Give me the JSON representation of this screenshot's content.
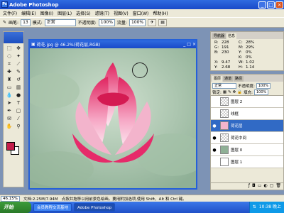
{
  "app": {
    "title": "Adobe Photoshop",
    "icon_label": "Ps"
  },
  "menus": [
    "文件(F)",
    "编辑(E)",
    "图像(I)",
    "图层(L)",
    "选择(S)",
    "滤镜(T)",
    "视图(V)",
    "窗口(W)",
    "帮助(H)"
  ],
  "options": {
    "brush_label": "画笔:",
    "brush_size": "13",
    "mode_label": "模式:",
    "mode_value": "正常",
    "opacity_label": "不透明度:",
    "opacity_value": "100%",
    "flow_label": "流量:",
    "flow_value": "100%"
  },
  "document": {
    "title": "荷花.jpg @ 46.2%(荷花层,RGB)"
  },
  "navigator": {
    "tabs": [
      "导航器",
      "信息"
    ],
    "info": [
      {
        "l1": "R:",
        "v1": "228",
        "l2": "C:",
        "v2": "28%"
      },
      {
        "l1": "G:",
        "v1": "191",
        "l2": "M:",
        "v2": "29%"
      },
      {
        "l1": "B:",
        "v1": "230",
        "l2": "Y:",
        "v2": "0%"
      },
      {
        "l1": "",
        "v1": "",
        "l2": "K:",
        "v2": "0%"
      },
      {
        "l1": "X:",
        "v1": "9.47",
        "l2": "W:",
        "v2": "1.02"
      },
      {
        "l1": "Y:",
        "v1": "2.68",
        "l2": "H:",
        "v2": "1.14"
      }
    ]
  },
  "layers": {
    "tabs": [
      "图层",
      "通道",
      "路径"
    ],
    "blend_mode": "正常",
    "opacity_label": "不透明度:",
    "opacity_value": "100%",
    "lock_label": "锁定:",
    "fill_label": "填充:",
    "fill_value": "100%",
    "items": [
      {
        "name": "图层 2",
        "visible": false,
        "selected": false
      },
      {
        "name": "线框",
        "visible": false,
        "selected": false
      },
      {
        "name": "荷花层",
        "visible": true,
        "selected": true
      },
      {
        "name": "荷花中间",
        "visible": true,
        "selected": false
      },
      {
        "name": "图层 0",
        "visible": true,
        "selected": false
      },
      {
        "name": "图层 1",
        "visible": false,
        "selected": false
      }
    ]
  },
  "status": {
    "zoom": "46.15%",
    "doc_size": "文档:2.25M/7.94M",
    "hint": "点按并拖移以用前景色绘画。要用附加选项,使用 Shift、Alt 和 Ctrl 键。"
  },
  "taskbar": {
    "start": "开始",
    "buttons": [
      "会员教程交流基地",
      "Adobe Photoshop"
    ],
    "clock": "10:38 晚上"
  },
  "colors": {
    "foreground": "#c41d4a",
    "background": "#ffffff"
  }
}
